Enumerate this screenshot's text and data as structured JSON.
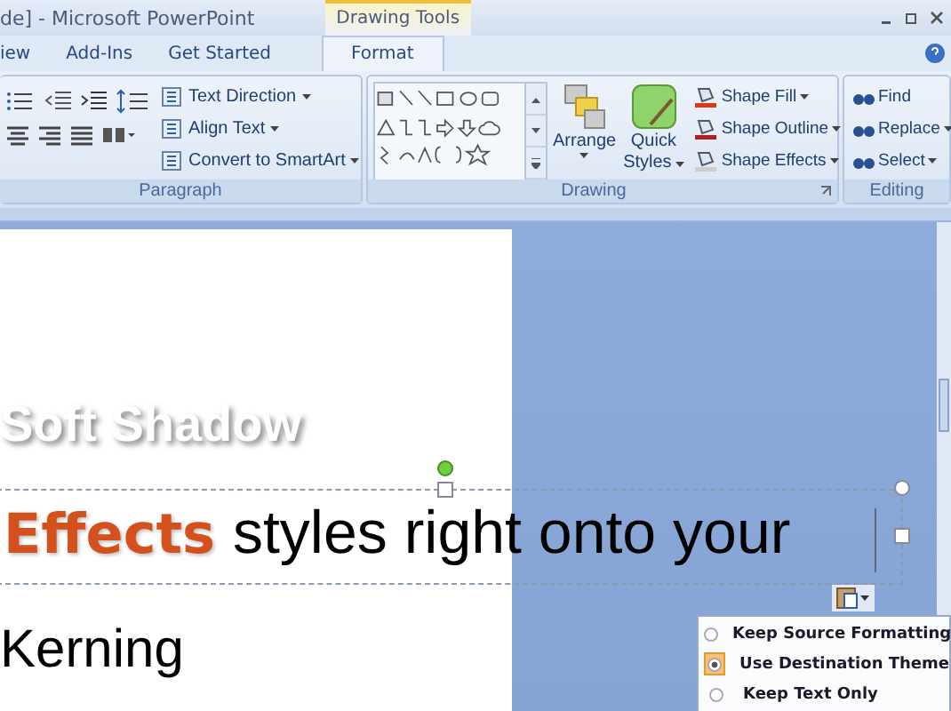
{
  "title_bar": {
    "title": "de] - Microsoft PowerPoint",
    "context_tab": "Drawing Tools"
  },
  "tabs": [
    {
      "label": "iew",
      "selected": false
    },
    {
      "label": "Add-Ins",
      "selected": false
    },
    {
      "label": "Get Started",
      "selected": false
    },
    {
      "label": "Format",
      "selected": true
    }
  ],
  "paragraph_group": {
    "title": "Paragraph",
    "commands": [
      "Text Direction",
      "Align Text",
      "Convert to SmartArt"
    ]
  },
  "drawing_group": {
    "title": "Drawing",
    "arrange": "Arrange",
    "quick_styles": [
      "Quick",
      "Styles"
    ],
    "commands": [
      "Shape Fill",
      "Shape Outline",
      "Shape Effects"
    ]
  },
  "editing_group": {
    "title": "Editing",
    "commands": [
      "Find",
      "Replace",
      "Select"
    ]
  },
  "slide": {
    "shadow_text": "Soft Shadow",
    "highlight": "Effects",
    "line_text": "styles right onto your",
    "kerning_text": "Kerning"
  },
  "paste_options": [
    {
      "label": "Keep Source Formatting",
      "selected": false
    },
    {
      "label": "Use Destination Theme",
      "selected": true
    },
    {
      "label": "Keep Text Only",
      "selected": false
    }
  ]
}
